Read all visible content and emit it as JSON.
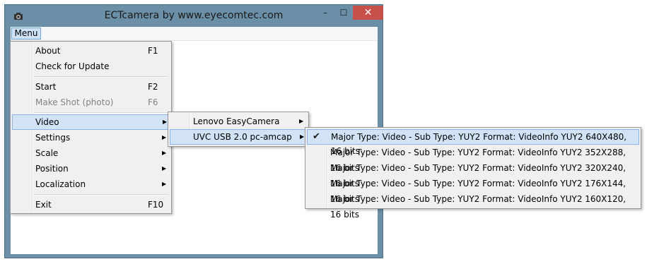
{
  "window": {
    "title": "ECTcamera by www.eyecomtec.com",
    "icon": "camera-icon",
    "minimize_glyph": "–",
    "maximize_glyph": "☐",
    "close_glyph": "✕",
    "close_color": "#c7504a"
  },
  "menubar": {
    "menu_label": "Menu"
  },
  "main_menu": {
    "about": {
      "label": "About",
      "shortcut": "F1"
    },
    "check_update": {
      "label": "Check for Update"
    },
    "start": {
      "label": "Start",
      "shortcut": "F2"
    },
    "make_shot": {
      "label": "Make Shot (photo)",
      "shortcut": "F6",
      "disabled": true
    },
    "video": {
      "label": "Video"
    },
    "settings": {
      "label": "Settings"
    },
    "scale": {
      "label": "Scale"
    },
    "position": {
      "label": "Position"
    },
    "localization": {
      "label": "Localization"
    },
    "exit": {
      "label": "Exit",
      "shortcut": "F10"
    }
  },
  "video_submenu": {
    "items": [
      {
        "label": "Lenovo EasyCamera"
      },
      {
        "label": "UVC USB 2.0 pc-amcap"
      }
    ]
  },
  "format_submenu": {
    "items": [
      {
        "label": "Major Type: Video - Sub Type: YUY2 Format: VideoInfo YUY2 640X480, 16 bits",
        "checked": true
      },
      {
        "label": "Major Type: Video - Sub Type: YUY2 Format: VideoInfo YUY2 352X288, 16 bits",
        "checked": false
      },
      {
        "label": "Major Type: Video - Sub Type: YUY2 Format: VideoInfo YUY2 320X240, 16 bits",
        "checked": false
      },
      {
        "label": "Major Type: Video - Sub Type: YUY2 Format: VideoInfo YUY2 176X144, 16 bits",
        "checked": false
      },
      {
        "label": "Major Type: Video - Sub Type: YUY2 Format: VideoInfo YUY2 160X120, 16 bits",
        "checked": false
      }
    ]
  },
  "glyphs": {
    "submenu_arrow": "▶",
    "check": "✔"
  },
  "colors": {
    "highlight": "#d1e3f5",
    "frame": "#6b8fa6",
    "disabled_text": "#838383"
  }
}
